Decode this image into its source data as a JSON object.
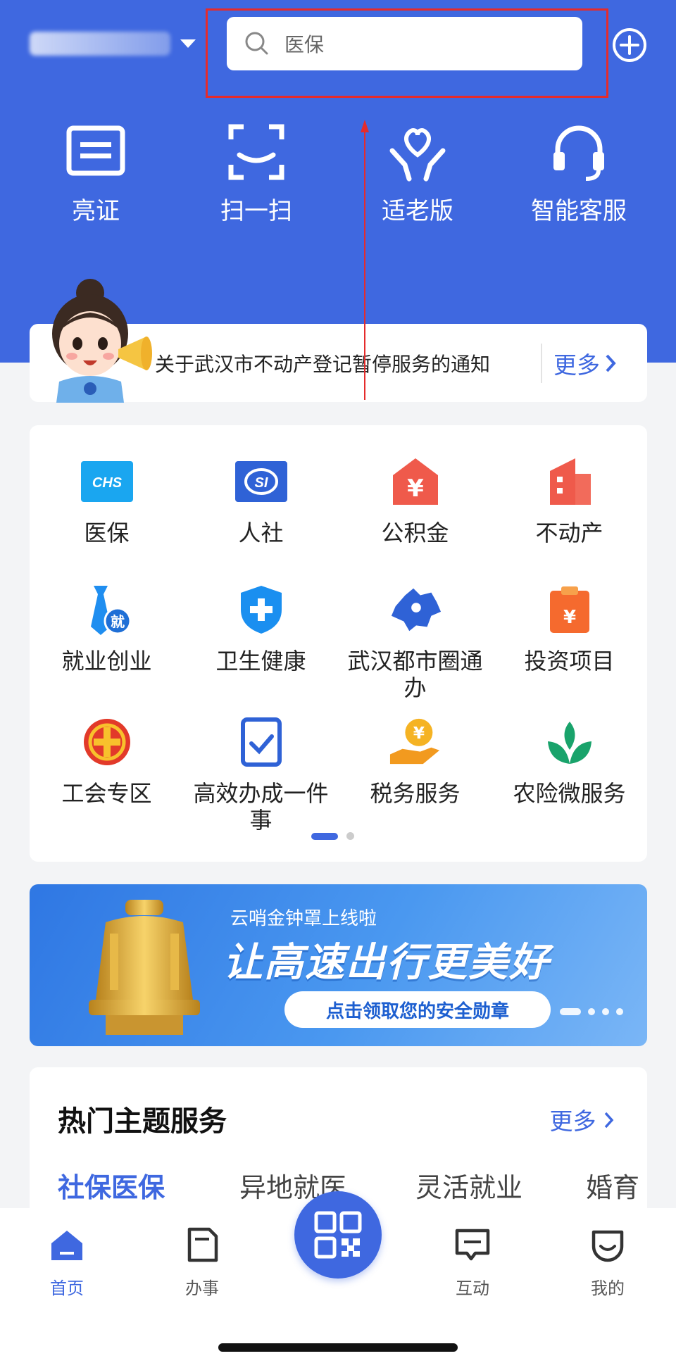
{
  "header": {
    "location": "",
    "search_placeholder": "医保"
  },
  "quick_actions": [
    {
      "label": "亮证",
      "icon": "id-card-icon"
    },
    {
      "label": "扫一扫",
      "icon": "scan-icon"
    },
    {
      "label": "适老版",
      "icon": "elderly-heart-icon"
    },
    {
      "label": "智能客服",
      "icon": "headset-icon"
    }
  ],
  "notice": {
    "text": "关于武汉市不动产登记暂停服务的通知",
    "more": "更多"
  },
  "services": [
    {
      "label": "医保",
      "icon": "chs-icon"
    },
    {
      "label": "人社",
      "icon": "si-icon"
    },
    {
      "label": "公积金",
      "icon": "housing-fund-icon"
    },
    {
      "label": "不动产",
      "icon": "real-estate-icon"
    },
    {
      "label": "就业创业",
      "icon": "employment-icon"
    },
    {
      "label": "卫生健康",
      "icon": "health-shield-icon"
    },
    {
      "label": "武汉都市圈通办",
      "icon": "map-icon"
    },
    {
      "label": "投资项目",
      "icon": "investment-icon"
    },
    {
      "label": "工会专区",
      "icon": "union-icon"
    },
    {
      "label": "高效办成一件事",
      "icon": "checklist-icon"
    },
    {
      "label": "税务服务",
      "icon": "tax-icon"
    },
    {
      "label": "农险微服务",
      "icon": "sprout-icon"
    }
  ],
  "banner": {
    "subtitle": "云哨金钟罩上线啦",
    "title": "让高速出行更美好",
    "button": "点击领取您的安全勋章"
  },
  "topics": {
    "title": "热门主题服务",
    "more": "更多",
    "tabs": [
      "社保医保",
      "异地就医",
      "灵活就业",
      "婚育"
    ]
  },
  "nav": {
    "items": [
      {
        "label": "首页",
        "icon": "home-icon"
      },
      {
        "label": "办事",
        "icon": "document-icon"
      },
      {
        "label": "互动",
        "icon": "chat-icon"
      },
      {
        "label": "我的",
        "icon": "profile-icon"
      }
    ]
  },
  "colors": {
    "primary": "#3f68e0",
    "annotation": "#e52b2b"
  }
}
